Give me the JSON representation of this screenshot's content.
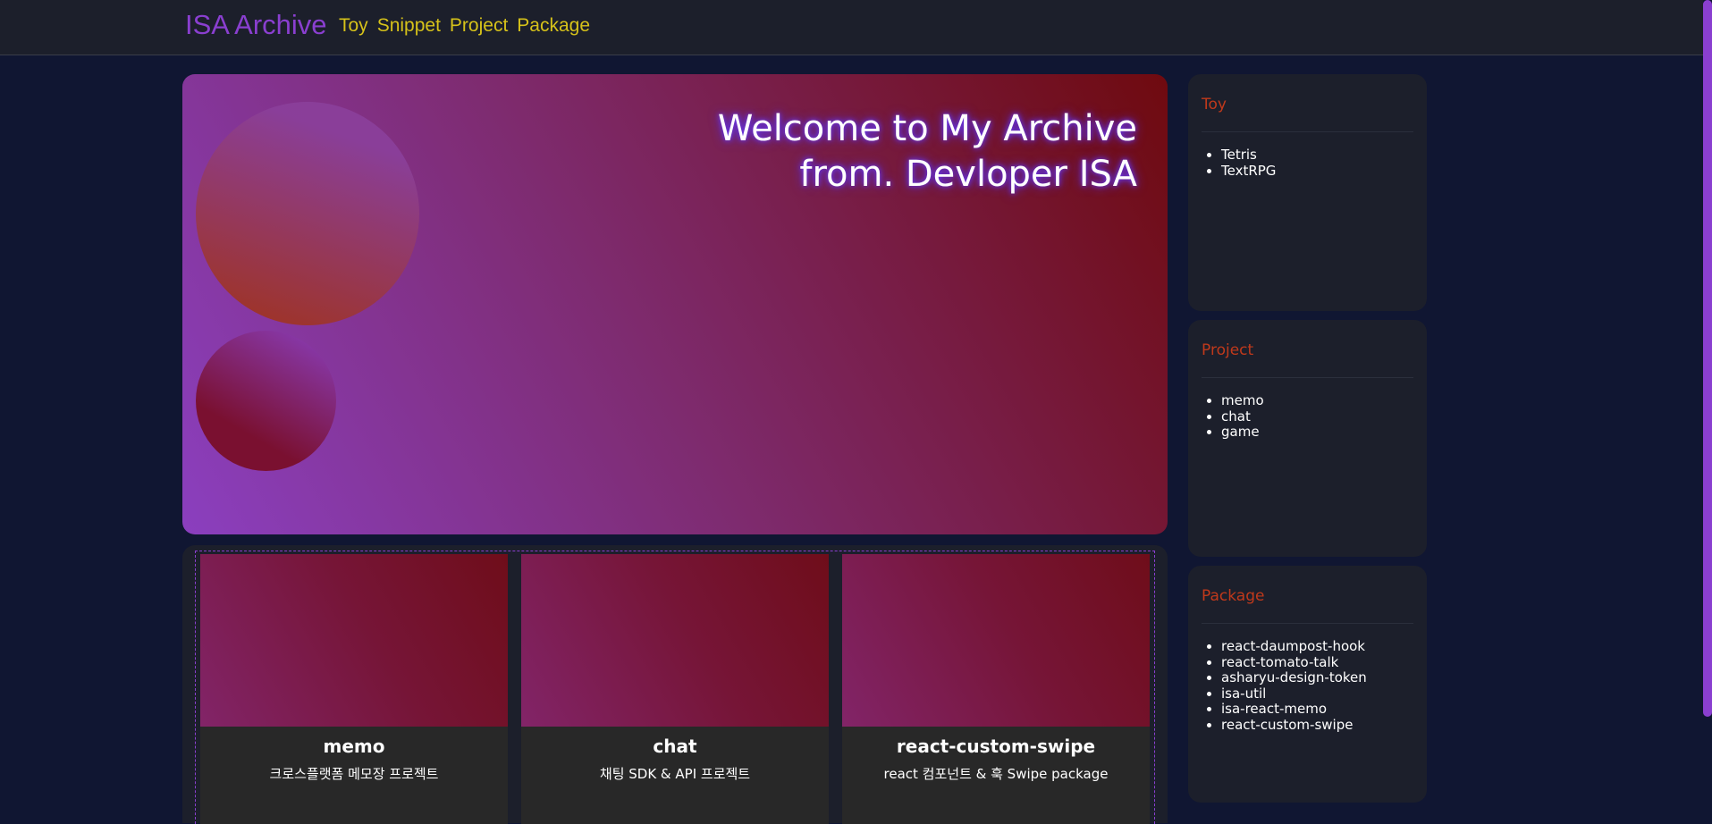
{
  "header": {
    "brand": "ISA Archive",
    "nav": [
      "Toy",
      "Snippet",
      "Project",
      "Package"
    ]
  },
  "hero": {
    "title_line1": "Welcome to My Archive",
    "title_line2": "from. Devloper ISA"
  },
  "cards": [
    {
      "title": "memo",
      "description": "크로스플랫폼 메모장 프로젝트"
    },
    {
      "title": "chat",
      "description": "채팅 SDK & API 프로젝트"
    },
    {
      "title": "react-custom-swipe",
      "description": "react 컴포넌트 & 훅 Swipe package"
    }
  ],
  "sidebar": [
    {
      "title": "Toy",
      "items": [
        "Tetris",
        "TextRPG"
      ]
    },
    {
      "title": "Project",
      "items": [
        "memo",
        "chat",
        "game"
      ]
    },
    {
      "title": "Package",
      "items": [
        "react-daumpost-hook",
        "react-tomato-talk",
        "asharyu-design-token",
        "isa-util",
        "isa-react-memo",
        "react-custom-swipe"
      ]
    }
  ],
  "colors": {
    "background": "#101632",
    "panel": "#1c1f2b",
    "brand": "#8a3fd0",
    "nav": "#d6c21a",
    "section_title": "#c0391b"
  }
}
